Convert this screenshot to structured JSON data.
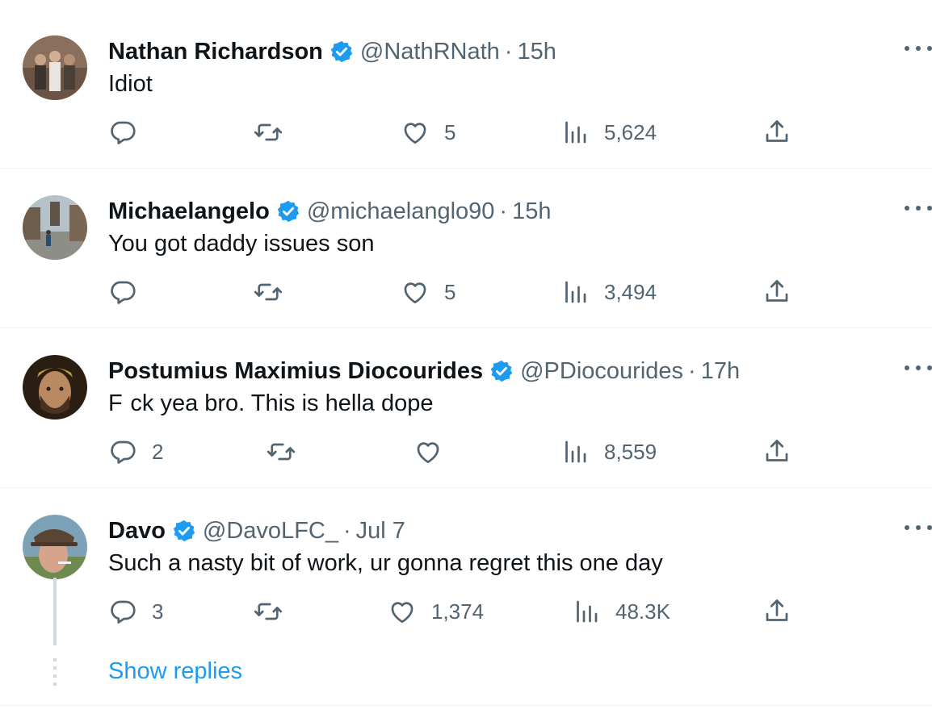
{
  "colors": {
    "accent": "#1d9bf0",
    "secondary": "#536471",
    "text": "#0f1419",
    "verified": "#1d9bf0"
  },
  "icons": [
    "reply-icon",
    "retweet-icon",
    "like-icon",
    "views-icon",
    "share-icon",
    "verified-icon",
    "more-icon"
  ],
  "tweets": [
    {
      "name": "Nathan Richardson",
      "handle": "@NathRNath",
      "sep": "·",
      "time": "15h",
      "text": "Idiot",
      "replies": "",
      "retweets": "",
      "likes": "5",
      "views": "5,624"
    },
    {
      "name": "Michaelangelo",
      "handle": "@michaelanglo90",
      "sep": "·",
      "time": "15h",
      "text": "You got daddy issues son",
      "replies": "",
      "retweets": "",
      "likes": "5",
      "views": "3,494"
    },
    {
      "name": "Postumius Maximius Diocourides",
      "handle": "@PDiocourides",
      "sep": "·",
      "time": "17h",
      "text": "F    ck yea bro. This is hella dope",
      "replies": "2",
      "retweets": "",
      "likes": "",
      "views": "8,559"
    },
    {
      "name": "Davo",
      "handle": "@DavoLFC_",
      "sep": "·",
      "time": "Jul 7",
      "text": "Such a nasty bit of work, ur gonna regret this one day",
      "replies": "3",
      "retweets": "",
      "likes": "1,374",
      "views": "48.3K"
    }
  ],
  "show_replies": "Show replies"
}
